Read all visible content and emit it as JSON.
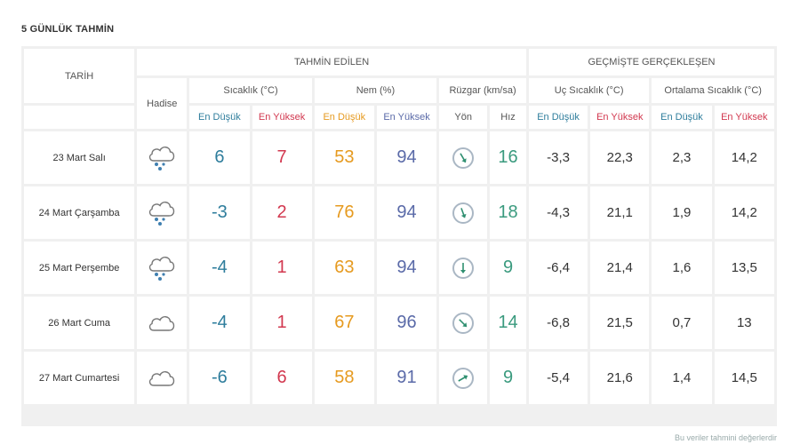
{
  "page": {
    "title": "5 GÜNLÜK TAHMİN",
    "footer_note": "Bu veriler tahmini değerlerdir"
  },
  "headers": {
    "date": "TARİH",
    "event": "Hadise",
    "forecast_group": "TAHMİN EDİLEN",
    "past_group": "GEÇMİŞTE GERÇEKLEŞEN",
    "temperature": "Sıcaklık (°C)",
    "humidity": "Nem (%)",
    "wind": "Rüzgar (km/sa)",
    "extreme_temp": "Uç Sıcaklık (°C)",
    "average_temp": "Ortalama Sıcaklık (°C)",
    "min": "En Düşük",
    "max": "En Yüksek",
    "direction": "Yön",
    "speed": "Hız"
  },
  "rows": [
    {
      "date": "23 Mart Salı",
      "icon": "snow-cloud-icon",
      "temp_min": "6",
      "temp_max": "7",
      "hum_min": "53",
      "hum_max": "94",
      "wind_dir_deg": 150,
      "wind_speed": "16",
      "ext_min": "-3,3",
      "ext_max": "22,3",
      "avg_min": "2,3",
      "avg_max": "14,2"
    },
    {
      "date": "24 Mart Çarşamba",
      "icon": "snow-cloud-icon",
      "temp_min": "-3",
      "temp_max": "2",
      "hum_min": "76",
      "hum_max": "94",
      "wind_dir_deg": 160,
      "wind_speed": "18",
      "ext_min": "-4,3",
      "ext_max": "21,1",
      "avg_min": "1,9",
      "avg_max": "14,2"
    },
    {
      "date": "25 Mart Perşembe",
      "icon": "snow-cloud-icon",
      "temp_min": "-4",
      "temp_max": "1",
      "hum_min": "63",
      "hum_max": "94",
      "wind_dir_deg": 180,
      "wind_speed": "9",
      "ext_min": "-6,4",
      "ext_max": "21,4",
      "avg_min": "1,6",
      "avg_max": "13,5"
    },
    {
      "date": "26 Mart Cuma",
      "icon": "cloud-icon",
      "temp_min": "-4",
      "temp_max": "1",
      "hum_min": "67",
      "hum_max": "96",
      "wind_dir_deg": 135,
      "wind_speed": "14",
      "ext_min": "-6,8",
      "ext_max": "21,5",
      "avg_min": "0,7",
      "avg_max": "13"
    },
    {
      "date": "27 Mart Cumartesi",
      "icon": "cloud-icon",
      "temp_min": "-6",
      "temp_max": "6",
      "hum_min": "58",
      "hum_max": "91",
      "wind_dir_deg": 60,
      "wind_speed": "9",
      "ext_min": "-5,4",
      "ext_max": "21,6",
      "avg_min": "1,4",
      "avg_max": "14,5"
    }
  ]
}
